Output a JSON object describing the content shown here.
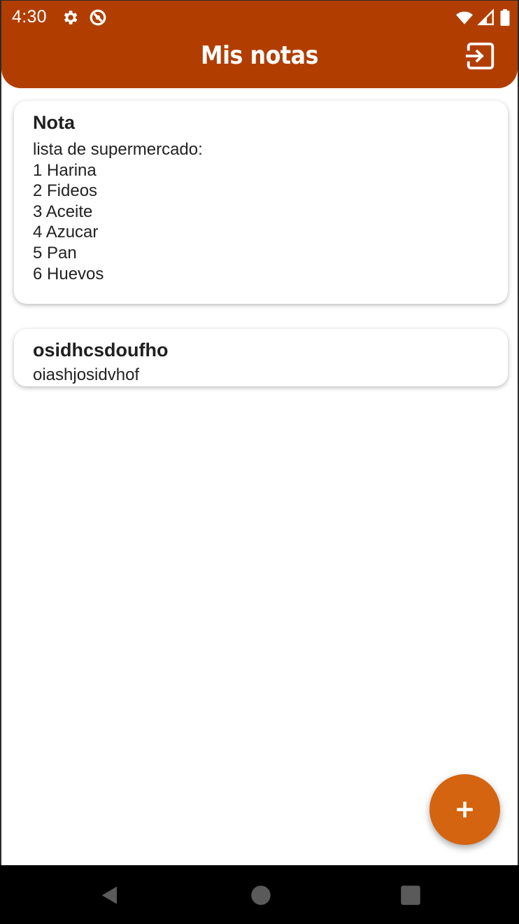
{
  "colors": {
    "header": "#b13e00",
    "fab": "#d4640f",
    "navbar": "#000000",
    "nav_icon": "#5a5a5a"
  },
  "status_bar": {
    "time": "4:30",
    "icons": [
      "settings-icon",
      "sync-disabled-icon",
      "wifi-icon",
      "signal-icon",
      "battery-icon"
    ]
  },
  "app_bar": {
    "title": "Mis notas",
    "action_icon": "logout-icon"
  },
  "notes": [
    {
      "title": "Nota",
      "body": "lista de supermercado:\n1 Harina\n2 Fideos\n3 Aceite\n4 Azucar\n5 Pan\n6 Huevos"
    },
    {
      "title": "osidhcsdoufho",
      "body": "oiashjosidvhof"
    }
  ],
  "fab": {
    "icon": "plus-icon"
  },
  "nav_bar": {
    "icons": [
      "back-icon",
      "home-icon",
      "recents-icon"
    ]
  }
}
